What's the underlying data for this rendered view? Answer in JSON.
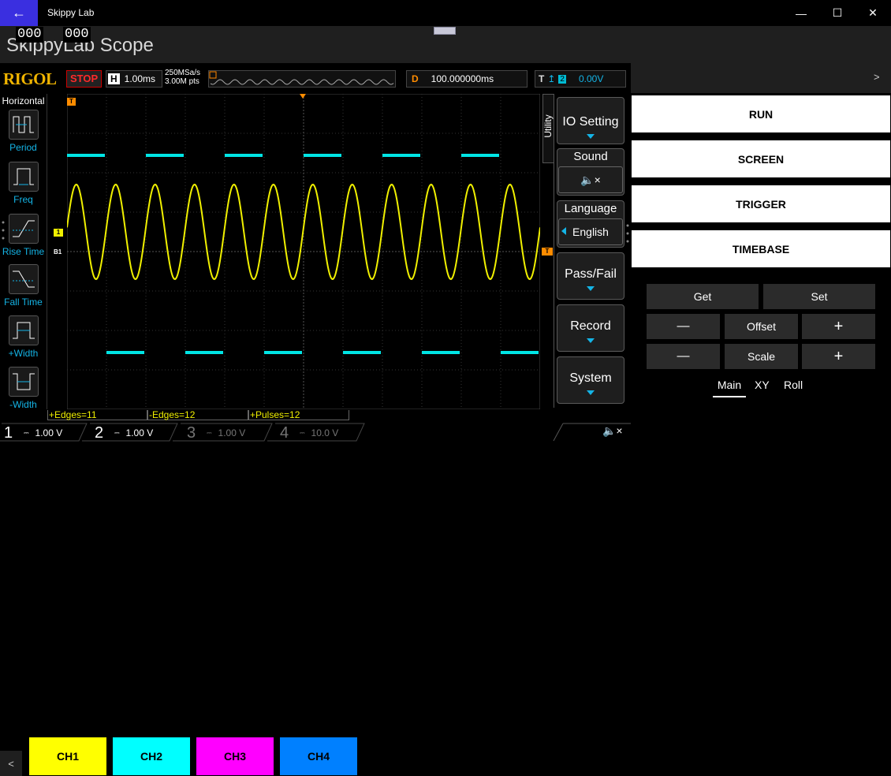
{
  "window": {
    "title": "Skippy Lab",
    "back_icon": "back-arrow-icon",
    "minimize_icon": "—",
    "maximize_icon": "☐",
    "close_icon": "✕"
  },
  "header": {
    "counter_left": "000",
    "counter_right": "000",
    "page_title": "SkippyLab Scope"
  },
  "scope": {
    "brand": "RIGOL",
    "run_state": "STOP",
    "timebase_label": "H",
    "timebase_value": "1.00ms",
    "sample_rate": "250MSa/s",
    "mem_depth": "3.00M pts",
    "delay_label": "D",
    "delay_value": "100.000000ms",
    "trigger_label": "T",
    "trigger_channel": "2",
    "trigger_level": "0.00V",
    "expand_glyph": ">",
    "left_panel": {
      "title": "Horizontal",
      "items": [
        "Period",
        "Freq",
        "Rise Time",
        "Fall Time",
        "+Width",
        "-Width"
      ]
    },
    "markers": {
      "trigger_top": "T",
      "ch1": "1",
      "b1": "B1",
      "trigger_right": "T"
    },
    "menu": {
      "utility_label": "Utility",
      "io_setting": "IO Setting",
      "sound_title": "Sound",
      "language_title": "Language",
      "language_value": "English",
      "pass_fail": "Pass/Fail",
      "record": "Record",
      "system": "System"
    },
    "measurements": [
      "+Edges=11",
      "-Edges=12",
      "+Pulses=12"
    ],
    "channels": [
      {
        "num": "1",
        "scale": "1.00 V",
        "color": "#f0f000",
        "active": true
      },
      {
        "num": "2",
        "scale": "1.00 V",
        "color": "#00e5e5",
        "active": true
      },
      {
        "num": "3",
        "scale": "1.00 V",
        "color": "#a000a0",
        "active": false
      },
      {
        "num": "4",
        "scale": "10.0 V",
        "color": "#2060c0",
        "active": false
      }
    ]
  },
  "control": {
    "buttons": [
      "RUN",
      "SCREEN",
      "TRIGGER",
      "TIMEBASE"
    ],
    "get": "Get",
    "set": "Set",
    "minus": "—",
    "plus": "+",
    "offset": "Offset",
    "scale": "Scale",
    "tabs": [
      "Main",
      "XY",
      "Roll"
    ],
    "active_tab": "Main"
  },
  "bottom": {
    "collapse_glyph": "<",
    "channels": [
      {
        "label": "CH1",
        "color": "#ffff00"
      },
      {
        "label": "CH2",
        "color": "#00ffff"
      },
      {
        "label": "CH3",
        "color": "#ff00ff"
      },
      {
        "label": "CH4",
        "color": "#0080ff"
      }
    ]
  },
  "colors": {
    "accent": "#3a2fe0",
    "brand": "#f0b400",
    "stop": "#ff2a2a",
    "ch1_trace": "#f0f000",
    "ch2_trace": "#00e5e5",
    "menu_accent": "#14b4e6"
  }
}
